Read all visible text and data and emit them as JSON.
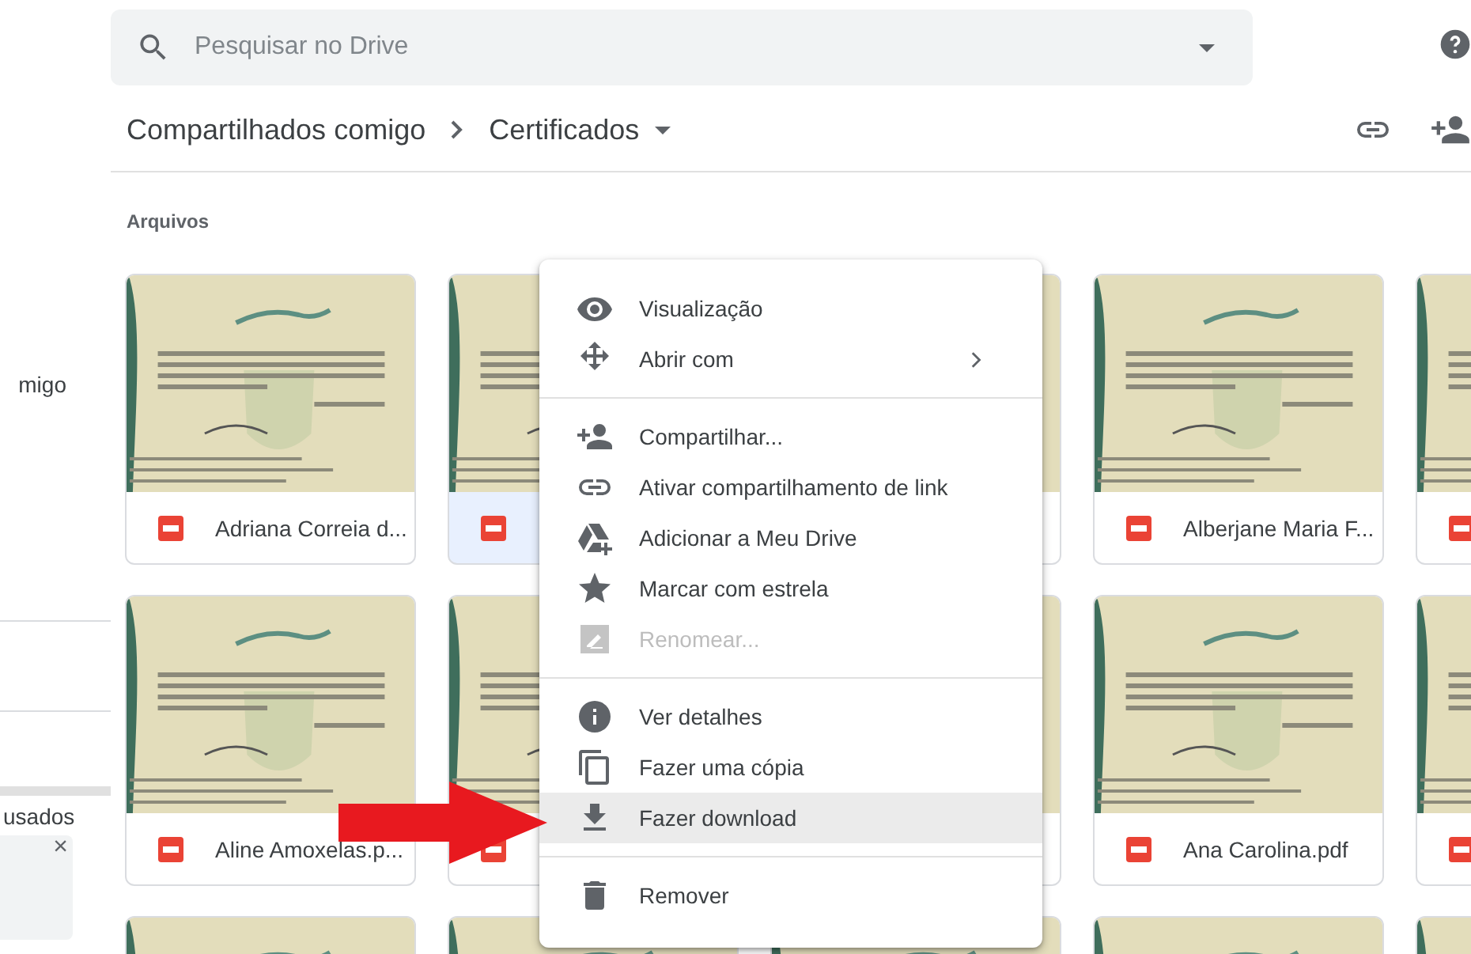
{
  "sidebar": {
    "texts": [
      "migo",
      "usados"
    ],
    "notice": {
      "close": "×"
    }
  },
  "search": {
    "placeholder": "Pesquisar no Drive"
  },
  "breadcrumb": [
    {
      "label": "Compartilhados comigo"
    },
    {
      "label": "Certificados"
    }
  ],
  "section_title": "Arquivos",
  "files": [
    {
      "name": "Adriana Correia d...",
      "kind": "pdf",
      "selected": false,
      "thumbnail": {
        "kind": "picture"
      }
    },
    {
      "kind": "pdf",
      "selected": true,
      "thumbnail": {
        "kind": "picture"
      }
    },
    {
      "selected": false,
      "thumbnail": {
        "kind": "picture"
      }
    },
    {
      "name": "Alberjane Maria F...",
      "kind": "pdf",
      "selected": false,
      "thumbnail": {
        "kind": "picture"
      }
    },
    {
      "kind": "pdf",
      "selected": false,
      "thumbnail": {
        "kind": "picture"
      }
    },
    {
      "name": "Aline Amoxelas.p...",
      "kind": "pdf",
      "selected": false,
      "thumbnail": {
        "kind": "picture"
      }
    },
    {
      "kind": "pdf",
      "selected": false,
      "thumbnail": {
        "kind": "picture"
      }
    },
    {
      "selected": false,
      "thumbnail": {
        "kind": "picture"
      }
    },
    {
      "name": "Ana Carolina.pdf",
      "kind": "pdf",
      "selected": false,
      "thumbnail": {
        "kind": "picture"
      }
    },
    {
      "kind": "pdf",
      "selected": false,
      "thumbnail": {
        "kind": "picture"
      }
    },
    {
      "thumbnail": {
        "kind": "picture"
      }
    },
    {
      "thumbnail": {
        "kind": "picture"
      }
    },
    {
      "thumbnail": {
        "kind": "picture"
      }
    },
    {
      "thumbnail": {
        "kind": "picture"
      }
    },
    {
      "thumbnail": {
        "kind": "picture"
      }
    }
  ],
  "context_menu": {
    "groups": [
      [
        {
          "label": "Visualização",
          "disabled": false,
          "highlighted": false,
          "submenu": false
        },
        {
          "label": "Abrir com",
          "disabled": false,
          "highlighted": false,
          "submenu": true
        }
      ],
      [
        {
          "label": "Compartilhar...",
          "disabled": false,
          "highlighted": false,
          "submenu": false
        },
        {
          "label": "Ativar compartilhamento de link",
          "disabled": false,
          "highlighted": false,
          "submenu": false
        },
        {
          "label": "Adicionar a Meu Drive",
          "disabled": false,
          "highlighted": false,
          "submenu": false
        },
        {
          "label": "Marcar com estrela",
          "disabled": false,
          "highlighted": false,
          "submenu": false
        },
        {
          "label": "Renomear...",
          "disabled": true,
          "highlighted": false,
          "submenu": false
        }
      ],
      [
        {
          "label": "Ver detalhes",
          "disabled": false,
          "highlighted": false,
          "submenu": false
        },
        {
          "label": "Fazer uma cópia",
          "disabled": false,
          "highlighted": false,
          "submenu": false
        },
        {
          "label": "Fazer download",
          "disabled": false,
          "highlighted": true,
          "submenu": false
        }
      ],
      [
        {
          "label": "Remover",
          "disabled": false,
          "highlighted": false,
          "submenu": false
        }
      ]
    ]
  },
  "annotation": {
    "kind": "arrow"
  }
}
